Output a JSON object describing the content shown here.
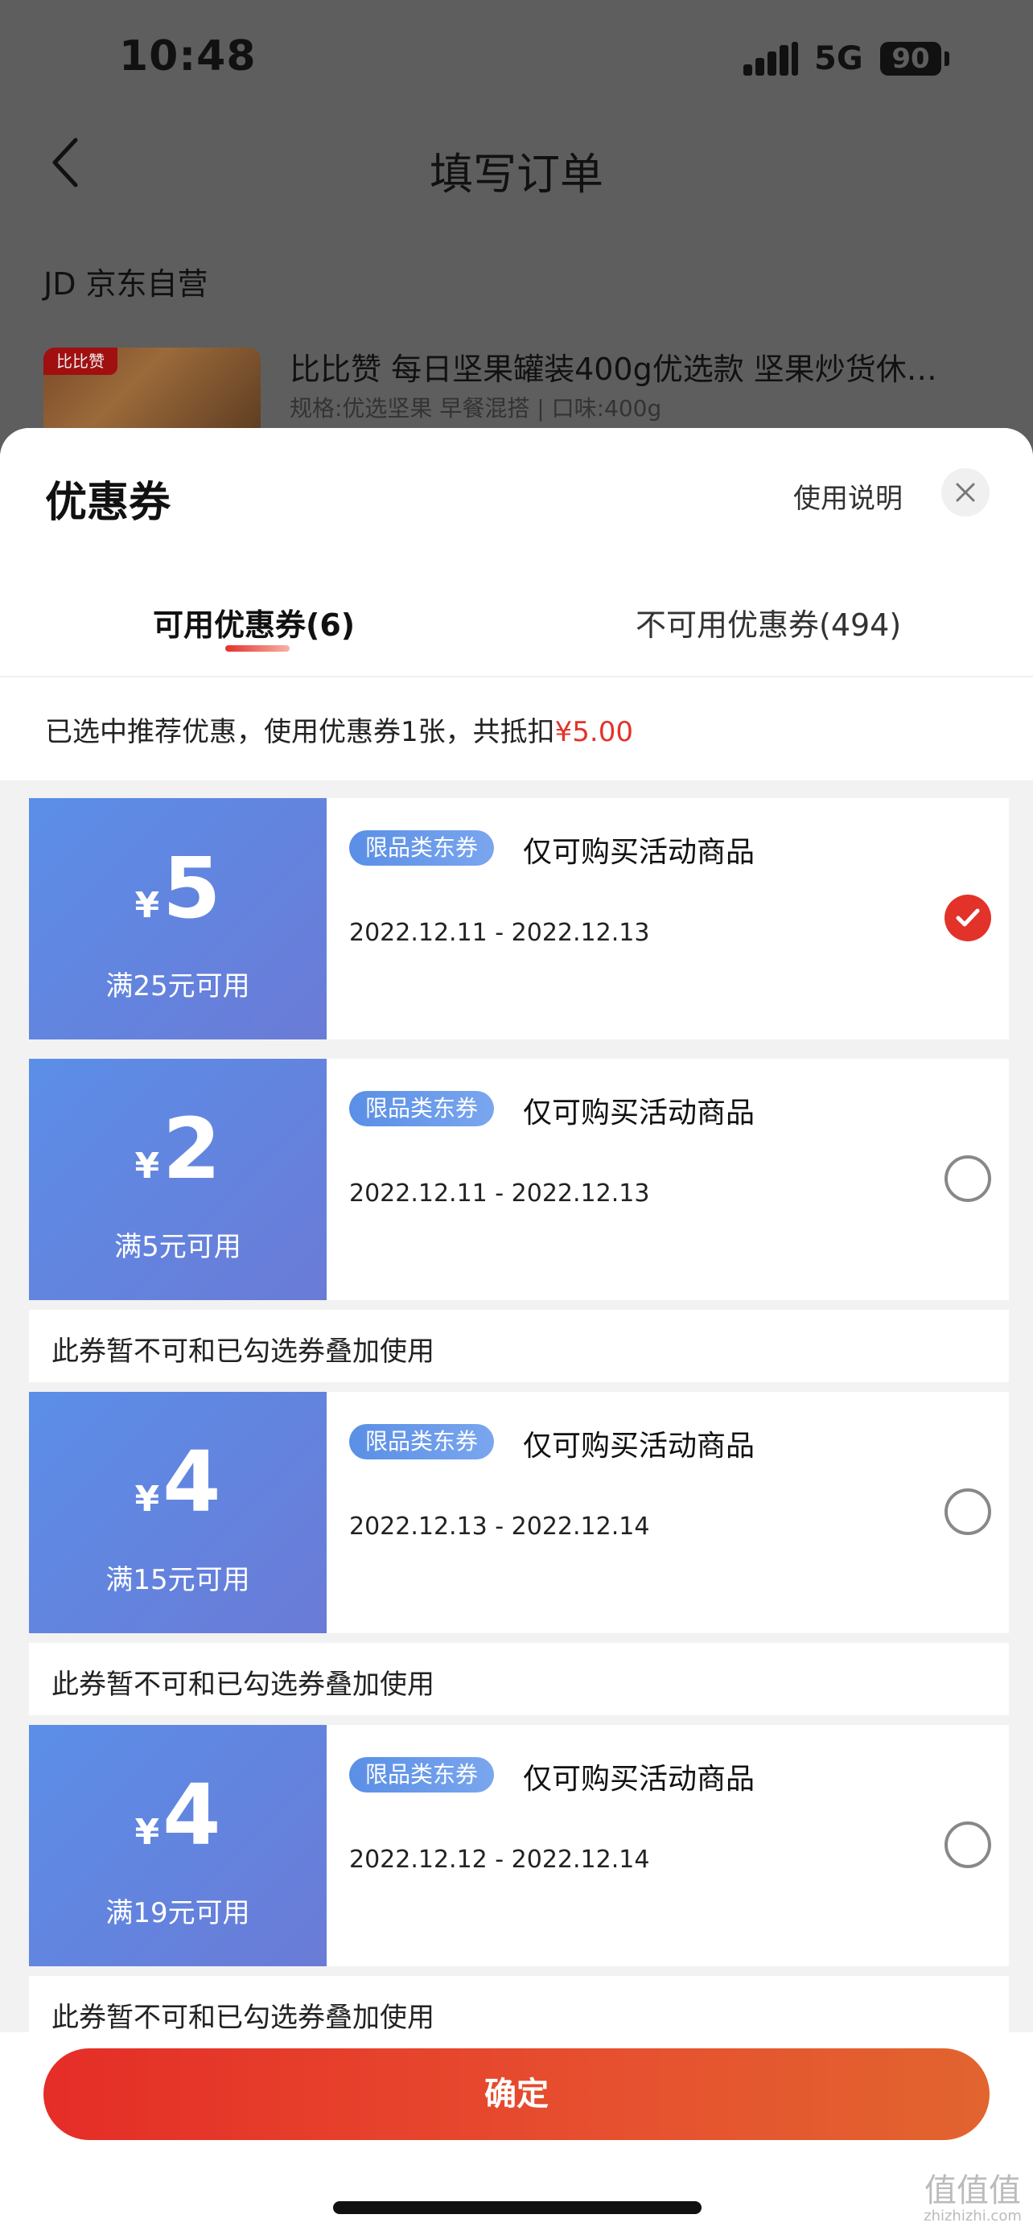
{
  "status_bar": {
    "time": "10:48",
    "network": "5G",
    "battery": "90"
  },
  "order_page": {
    "title": "填写订单",
    "shop": "JD 京东自营",
    "product_tag": "比比赞",
    "product_name": "比比赞 每日坚果罐装400g优选款 坚果炒货休…",
    "product_spec": "规格:优选坚果 早餐混搭 | 口味:400g"
  },
  "sheet": {
    "title": "优惠券",
    "help_label": "使用说明",
    "tabs": [
      {
        "label": "可用优惠券(6)",
        "active": true
      },
      {
        "label": "不可用优惠券(494)",
        "active": false
      }
    ],
    "summary_text": "已选中推荐优惠，使用优惠券1张，共抵扣",
    "summary_amount": "¥5.00"
  },
  "coupons": [
    {
      "currency": "¥",
      "amount": "5",
      "threshold": "满25元可用",
      "badge": "限品类东券",
      "scope": "仅可购买活动商品",
      "dates": "2022.12.11 - 2022.12.13",
      "selected": true,
      "note": ""
    },
    {
      "currency": "¥",
      "amount": "2",
      "threshold": "满5元可用",
      "badge": "限品类东券",
      "scope": "仅可购买活动商品",
      "dates": "2022.12.11 - 2022.12.13",
      "selected": false,
      "note": "此券暂不可和已勾选券叠加使用"
    },
    {
      "currency": "¥",
      "amount": "4",
      "threshold": "满15元可用",
      "badge": "限品类东券",
      "scope": "仅可购买活动商品",
      "dates": "2022.12.13 - 2022.12.14",
      "selected": false,
      "note": "此券暂不可和已勾选券叠加使用"
    },
    {
      "currency": "¥",
      "amount": "4",
      "threshold": "满19元可用",
      "badge": "限品类东券",
      "scope": "仅可购买活动商品",
      "dates": "2022.12.12 - 2022.12.14",
      "selected": false,
      "note": "此券暂不可和已勾选券叠加使用"
    }
  ],
  "confirm_label": "确定",
  "watermark": {
    "main": "值值值",
    "sub": "zhizhizhi.com"
  },
  "colors": {
    "accent": "#e3322a",
    "coupon_blue": "#5b8ee8"
  },
  "icons": {
    "back": "chevron-left-icon",
    "close": "close-icon",
    "check": "check-icon"
  }
}
